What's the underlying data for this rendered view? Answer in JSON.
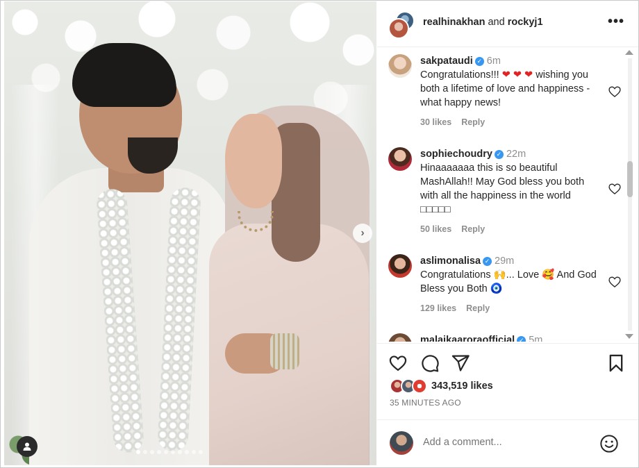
{
  "post": {
    "author_primary": "realhinakhan",
    "author_joiner": "and",
    "author_secondary": "rockyj1",
    "more_label": "•••",
    "image_next_label": "›",
    "carousel_dots": 10,
    "carousel_active": 0
  },
  "comments": [
    {
      "user": "sakpataudi",
      "verified": true,
      "time": "6m",
      "text_before": "Congratulations!!! ",
      "hearts": "❤ ❤ ❤",
      "text_after": " wishing you both a lifetime of love and happiness - what happy news!",
      "likes": "30 likes",
      "reply": "Reply"
    },
    {
      "user": "sophiechoudry",
      "verified": true,
      "time": "22m",
      "text": "Hinaaaaaaa this is so beautiful MashAllah!! May God bless you both with all the happiness in the world □□□□□",
      "likes": "50 likes",
      "reply": "Reply"
    },
    {
      "user": "aslimonalisa",
      "verified": true,
      "time": "29m",
      "text_before": "Congratulations ",
      "emoji1": "🙌",
      "text_mid": "... Love ",
      "emoji2": "🥰",
      "text_after": " And God Bless you Both ",
      "emoji3": "🧿",
      "likes": "129 likes",
      "reply": "Reply"
    },
    {
      "user": "malaikaaroraofficial",
      "verified": true,
      "time": "5m"
    }
  ],
  "actions": {
    "likes_count": "343,519 likes",
    "time_ago": "35 MINUTES AGO"
  },
  "composer": {
    "placeholder": "Add a comment..."
  },
  "colors": {
    "verified": "#3897f0",
    "text": "#262626",
    "muted": "#8e8e8e",
    "heart": "#e02424"
  }
}
